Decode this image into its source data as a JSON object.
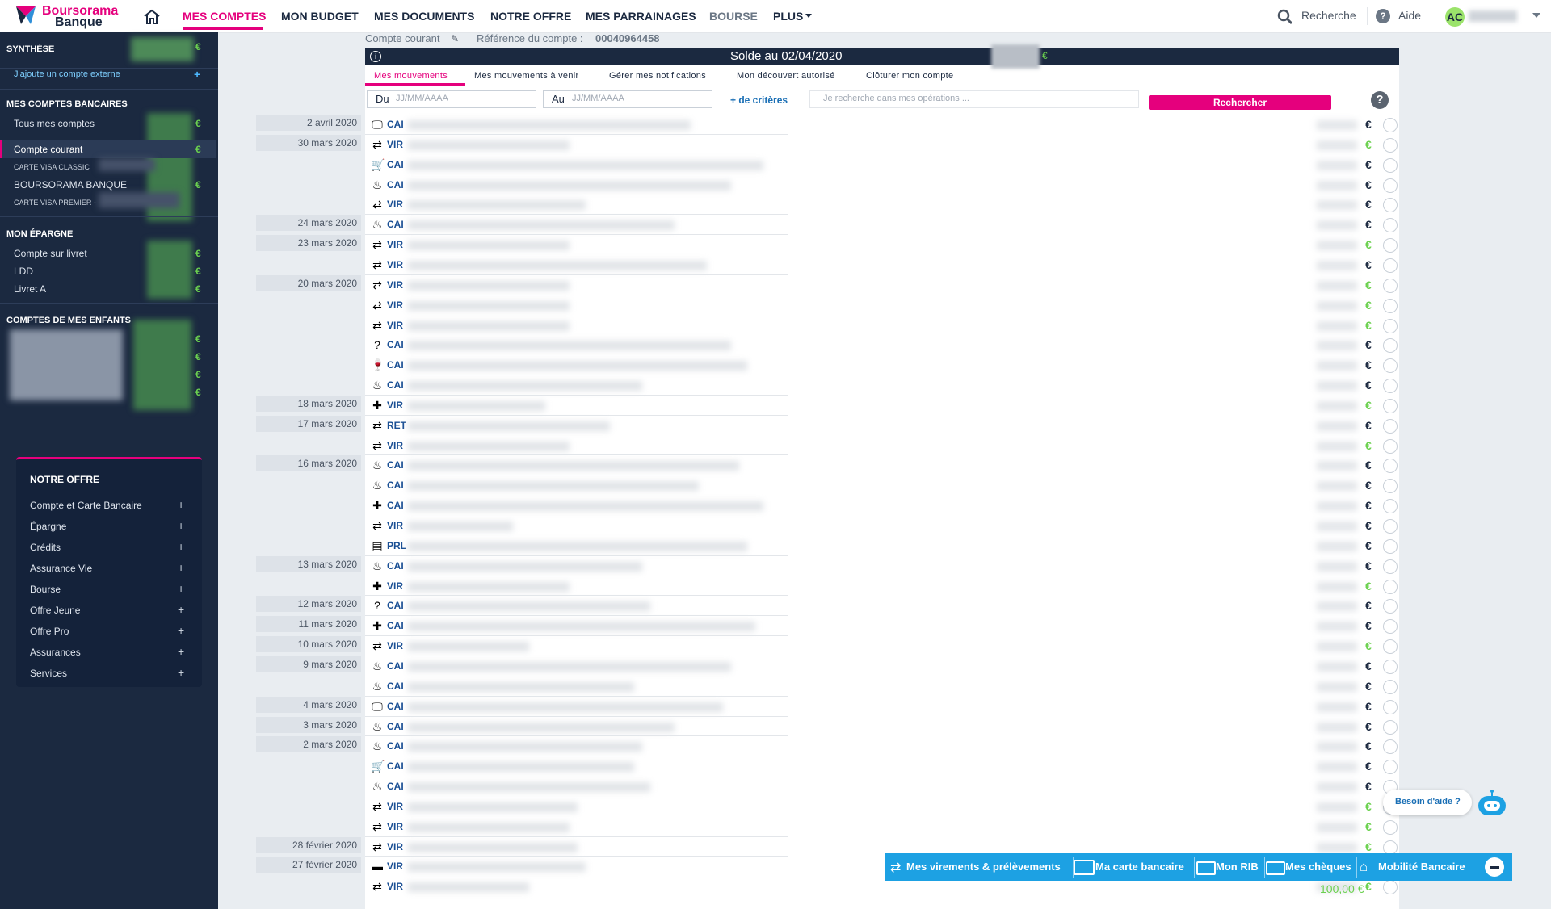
{
  "topbar": {
    "logo_line1": "Boursorama",
    "logo_line2": "Banque",
    "nav": [
      "MES COMPTES",
      "MON BUDGET",
      "MES DOCUMENTS",
      "NOTRE OFFRE",
      "MES PARRAINAGES",
      "BOURSE",
      "PLUS"
    ],
    "search_label": "Recherche",
    "help_label": "Aide",
    "avatar_initials": "AC"
  },
  "sidebar": {
    "synthese": "SYNTHÈSE",
    "add_external": "J'ajoute un compte externe",
    "bank_accounts_header": "MES COMPTES BANCAIRES",
    "all_accounts": "Tous mes comptes",
    "current_account": "Compte courant",
    "card_classic": "CARTE VISA CLASSIC",
    "boursorama_banque": "BOURSORAMA BANQUE",
    "card_premier": "CARTE VISA PREMIER -",
    "savings_header": "MON ÉPARGNE",
    "savings": [
      "Compte sur livret",
      "LDD",
      "Livret A"
    ],
    "children_header": "COMPTES DE MES ENFANTS",
    "euro": "€"
  },
  "offer": {
    "title": "NOTRE OFFRE",
    "items": [
      "Compte et Carte Bancaire",
      "Épargne",
      "Crédits",
      "Assurance Vie",
      "Bourse",
      "Offre Jeune",
      "Offre Pro",
      "Assurances",
      "Services"
    ]
  },
  "account": {
    "type": "Compte courant",
    "reference_label": "Référence du compte :",
    "reference_value": "00040964458",
    "balance_title": "Solde au 02/04/2020",
    "balance_currency": "€"
  },
  "tabs": [
    "Mes mouvements",
    "Mes mouvements à venir",
    "Gérer mes notifications",
    "Mon découvert autorisé",
    "Clôturer mon compte"
  ],
  "filters": {
    "from_label": "Du",
    "to_label": "Au",
    "date_placeholder": "JJ/MM/AAAA",
    "more_criteria": "+ de critères",
    "search_placeholder": "Je recherche dans mes opérations ...",
    "search_button": "Rechercher"
  },
  "operations": [
    {
      "date": "2 avril 2020",
      "icon": "monitor-icon",
      "label": "CAI",
      "sign": "neg"
    },
    {
      "date": "30 mars 2020",
      "icon": "transfer-icon",
      "label": "VIR",
      "sign": "pos"
    },
    {
      "date": "",
      "icon": "cart-icon",
      "label": "CAI",
      "sign": "neg"
    },
    {
      "date": "",
      "icon": "food-icon",
      "label": "CAI",
      "sign": "neg"
    },
    {
      "date": "",
      "icon": "transfer-icon",
      "label": "VIR",
      "sign": "neg"
    },
    {
      "date": "24 mars 2020",
      "icon": "food-icon",
      "label": "CAI",
      "sign": "neg"
    },
    {
      "date": "23 mars 2020",
      "icon": "transfer-icon",
      "label": "VIR",
      "sign": "pos"
    },
    {
      "date": "",
      "icon": "transfer-icon",
      "label": "VIR",
      "sign": "neg"
    },
    {
      "date": "20 mars 2020",
      "icon": "transfer-icon",
      "label": "VIR",
      "sign": "pos"
    },
    {
      "date": "",
      "icon": "transfer-icon",
      "label": "VIR",
      "sign": "pos"
    },
    {
      "date": "",
      "icon": "transfer-icon",
      "label": "VIR",
      "sign": "pos"
    },
    {
      "date": "",
      "icon": "question-icon",
      "label": "CAI",
      "sign": "neg"
    },
    {
      "date": "",
      "icon": "glass-icon",
      "label": "CAI",
      "sign": "neg"
    },
    {
      "date": "",
      "icon": "food-icon",
      "label": "CAI",
      "sign": "neg"
    },
    {
      "date": "18 mars 2020",
      "icon": "health-icon",
      "label": "VIR",
      "sign": "pos"
    },
    {
      "date": "17 mars 2020",
      "icon": "transfer-icon",
      "label": "RET",
      "sign": "neg"
    },
    {
      "date": "",
      "icon": "transfer-icon",
      "label": "VIR",
      "sign": "pos"
    },
    {
      "date": "16 mars 2020",
      "icon": "food-icon",
      "label": "CAI",
      "sign": "neg"
    },
    {
      "date": "",
      "icon": "food-icon",
      "label": "CAI",
      "sign": "neg"
    },
    {
      "date": "",
      "icon": "health-icon",
      "label": "CAI",
      "sign": "neg"
    },
    {
      "date": "",
      "icon": "transfer-icon",
      "label": "VIR",
      "sign": "neg"
    },
    {
      "date": "",
      "icon": "document-icon",
      "label": "PRL",
      "sign": "neg"
    },
    {
      "date": "13 mars 2020",
      "icon": "food-icon",
      "label": "CAI",
      "sign": "neg"
    },
    {
      "date": "",
      "icon": "health-icon",
      "label": "VIR",
      "sign": "pos"
    },
    {
      "date": "12 mars 2020",
      "icon": "question-icon",
      "label": "CAI",
      "sign": "neg"
    },
    {
      "date": "11 mars 2020",
      "icon": "health-icon",
      "label": "CAI",
      "sign": "neg"
    },
    {
      "date": "10 mars 2020",
      "icon": "transfer-icon",
      "label": "VIR",
      "sign": "pos"
    },
    {
      "date": "9 mars 2020",
      "icon": "food-icon",
      "label": "CAI",
      "sign": "neg"
    },
    {
      "date": "",
      "icon": "food-icon",
      "label": "CAI",
      "sign": "neg"
    },
    {
      "date": "4 mars 2020",
      "icon": "monitor-icon",
      "label": "CAI",
      "sign": "neg"
    },
    {
      "date": "3 mars 2020",
      "icon": "food-icon",
      "label": "CAI",
      "sign": "neg"
    },
    {
      "date": "2 mars 2020",
      "icon": "food-icon",
      "label": "CAI",
      "sign": "neg"
    },
    {
      "date": "",
      "icon": "cart-icon",
      "label": "CAI",
      "sign": "neg"
    },
    {
      "date": "",
      "icon": "food-icon",
      "label": "CAI",
      "sign": "neg"
    },
    {
      "date": "",
      "icon": "transfer-icon",
      "label": "VIR",
      "sign": "pos"
    },
    {
      "date": "",
      "icon": "transfer-icon",
      "label": "VIR",
      "sign": "pos"
    },
    {
      "date": "28 février 2020",
      "icon": "transfer-icon",
      "label": "VIR",
      "sign": "pos"
    },
    {
      "date": "27 février 2020",
      "icon": "wallet-icon",
      "label": "VIR",
      "sign": "pos"
    },
    {
      "date": "",
      "icon": "transfer-icon",
      "label": "VIR",
      "sign": "pos"
    }
  ],
  "bottom_amount": "100,00 €",
  "help_bubble": "Besoin d'aide ?",
  "quickbar": [
    "Mes virements & prélèvements",
    "Ma carte bancaire",
    "Mon RIB",
    "Mes chèques",
    "Mobilité Bancaire"
  ],
  "colors": {
    "brand_pink": "#e5007d",
    "navy": "#1b2940",
    "positive": "#6bd14f",
    "quickbar": "#1da1e3"
  }
}
